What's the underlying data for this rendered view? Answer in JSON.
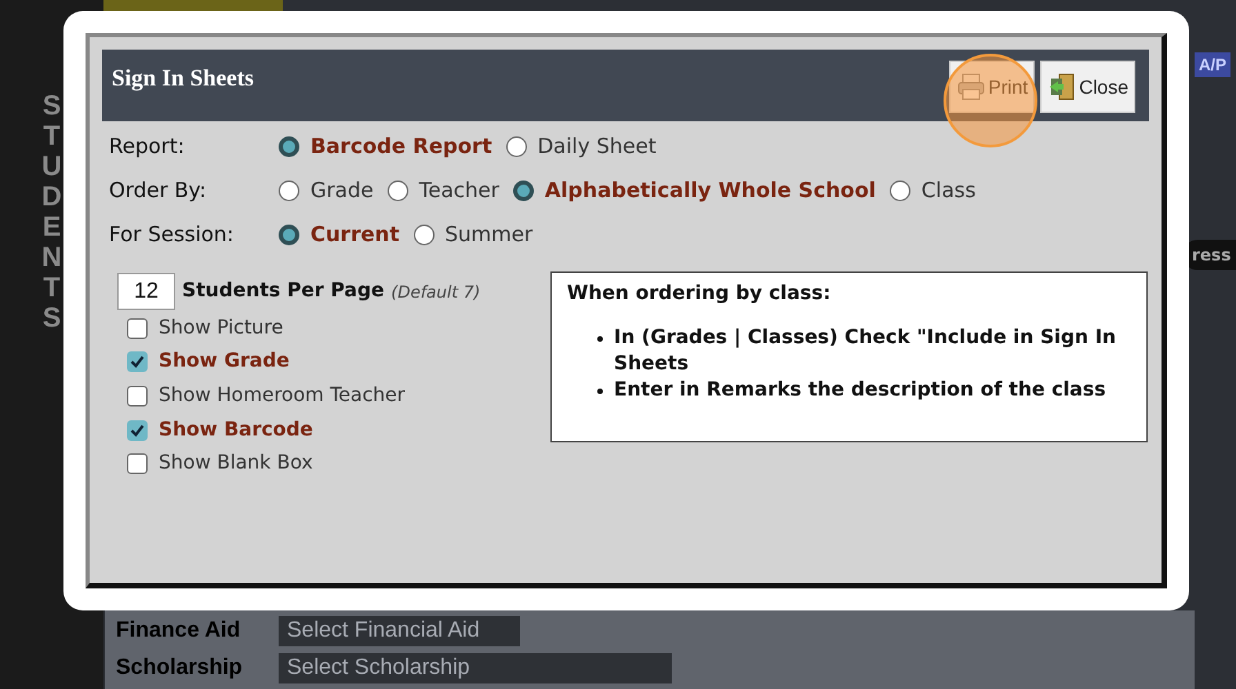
{
  "background": {
    "sidebar_title": "STUDENTS",
    "badge": "A/P",
    "tab_fragment": "ress",
    "fields": [
      {
        "label": "Finance Aid",
        "placeholder": "Select Financial Aid"
      },
      {
        "label": "Scholarship",
        "placeholder": "Select Scholarship"
      }
    ]
  },
  "dialog": {
    "title": "Sign In Sheets",
    "buttons": [
      {
        "label": "Print",
        "kind": "print"
      },
      {
        "label": "Close",
        "kind": "close"
      }
    ],
    "option_groups": [
      {
        "label": "Report:",
        "options": [
          {
            "label": "Barcode Report",
            "selected": true
          },
          {
            "label": "Daily Sheet",
            "selected": false
          }
        ]
      },
      {
        "label": "Order By:",
        "options": [
          {
            "label": "Grade",
            "selected": false
          },
          {
            "label": "Teacher",
            "selected": false
          },
          {
            "label": "Alphabetically Whole School",
            "selected": true
          },
          {
            "label": "Class",
            "selected": false
          }
        ]
      },
      {
        "label": "For Session:",
        "options": [
          {
            "label": "Current",
            "selected": true
          },
          {
            "label": "Summer",
            "selected": false
          }
        ]
      }
    ],
    "per_page": {
      "value": "12",
      "label": "Students Per Page",
      "hint": "(Default 7)"
    },
    "checkboxes": [
      {
        "label": "Show Picture",
        "checked": false
      },
      {
        "label": "Show Grade",
        "checked": true
      },
      {
        "label": "Show Homeroom Teacher",
        "checked": false
      },
      {
        "label": "Show Barcode",
        "checked": true
      },
      {
        "label": "Show Blank Box",
        "checked": false
      }
    ],
    "note": {
      "heading": "When ordering by class:",
      "items": [
        "In (Grades | Classes) Check \"Include in Sign In Sheets",
        "Enter in Remarks the description of the class"
      ]
    }
  }
}
